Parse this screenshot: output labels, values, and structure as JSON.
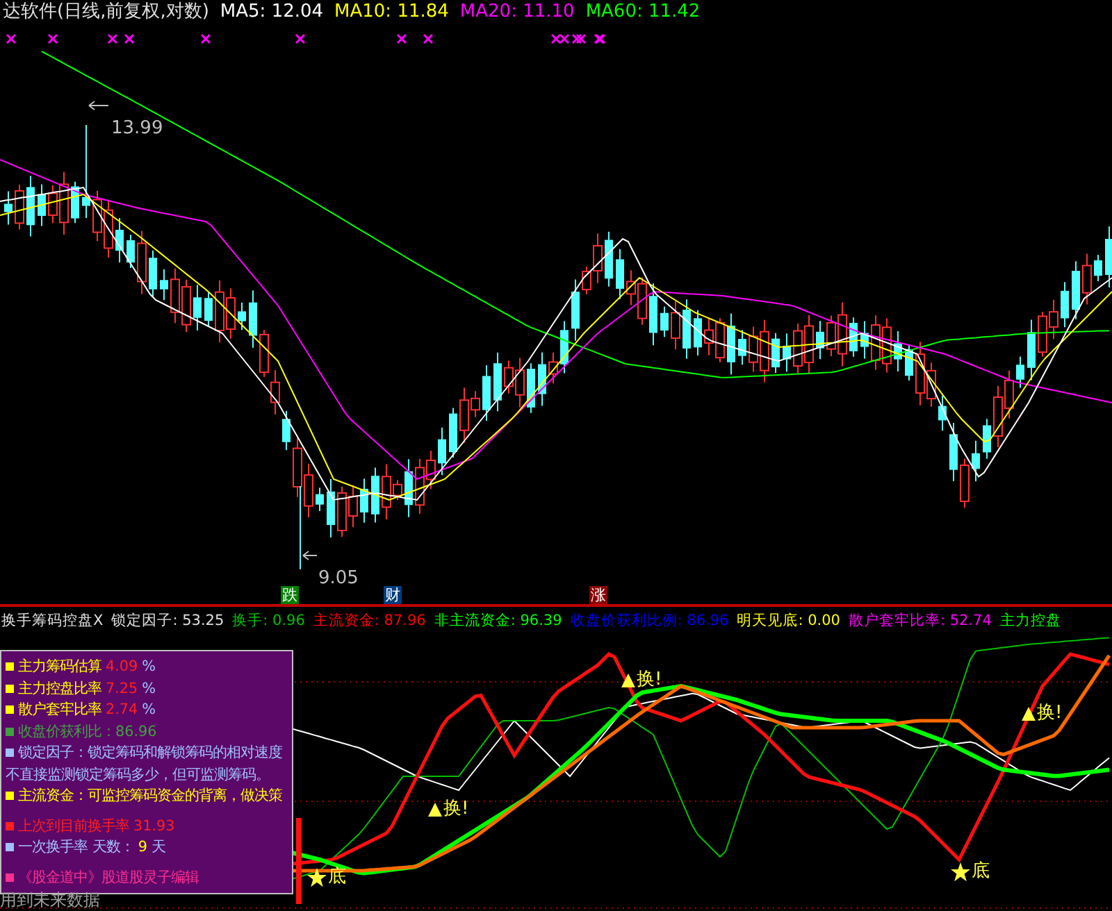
{
  "header": {
    "title": "达软件(日线,前复权,对数)",
    "ma": [
      {
        "label": "MA5: 12.04",
        "color": "#ffffff"
      },
      {
        "label": "MA10: 11.84",
        "color": "#ffff00"
      },
      {
        "label": "MA20: 11.10",
        "color": "#ff00ff"
      },
      {
        "label": "MA60: 11.42",
        "color": "#00ff00"
      }
    ]
  },
  "price_chart": {
    "high_label": "13.99",
    "low_label": "9.05",
    "badges": [
      {
        "text": "跌",
        "color": "#008000"
      },
      {
        "text": "财",
        "color": "#003f7f"
      },
      {
        "text": "涨",
        "color": "#8b0000"
      }
    ]
  },
  "indicator": {
    "name": "换手筹码控盘X",
    "readings": [
      {
        "text": "锁定因子: 53.25",
        "color": "#e0e0e0"
      },
      {
        "text": "换手: 0.96",
        "color": "#00c000"
      },
      {
        "text": "主流资金: 87.96",
        "color": "#ff0000"
      },
      {
        "text": "非主流资金: 96.39",
        "color": "#00ff00"
      },
      {
        "text": "收盘价获利比例: 86.96",
        "color": "#0000ff"
      },
      {
        "text": "明天见底: 0.00",
        "color": "#ffff00"
      },
      {
        "text": "散户套牢比率: 52.74",
        "color": "#ff00ff"
      },
      {
        "text": "主力控盘",
        "color": "#00ff00"
      }
    ]
  },
  "lower_chart": {
    "signals": [
      {
        "kind": "bottom",
        "text": "底"
      },
      {
        "kind": "swap",
        "text": "换!"
      },
      {
        "kind": "swap",
        "text": "换!"
      },
      {
        "kind": "bottom",
        "text": "底"
      },
      {
        "kind": "swap",
        "text": "换!"
      }
    ]
  },
  "info_panel": {
    "lines": [
      {
        "kind": "stat",
        "text": "主力筹码估算",
        "value": "4.09",
        "unit": "%",
        "color": "#ffff00"
      },
      {
        "kind": "stat",
        "text": "主力控盘比率",
        "value": "7.25",
        "unit": "%",
        "color": "#ffff00"
      },
      {
        "kind": "stat",
        "text": "散户套牢比率",
        "value": "2.74",
        "unit": "%",
        "color": "#ffff00"
      },
      {
        "kind": "note",
        "text": "收盘价获利比：86.96",
        "color": "#40a040"
      },
      {
        "kind": "note",
        "text": "锁定因子：锁定筹码和解锁筹码的相对速度",
        "color": "#a0c0ff"
      },
      {
        "kind": "plain",
        "text": "不直接监测锁定筹码多少，但可监测筹码。",
        "color": "#a0c0ff"
      },
      {
        "kind": "note",
        "text": "主流资金：可监控筹码资金的背离，做决策",
        "color": "#ffff00"
      },
      {
        "kind": "stat",
        "text": "上次到目前换手率",
        "value": "31.93",
        "color": "#ff2020"
      },
      {
        "kind": "stat",
        "text": "一次换手率 天数：",
        "value": "9",
        "unit": "天",
        "color": "#a0c0ff"
      },
      {
        "kind": "note",
        "text": "《股金道中》股道股灵子编辑",
        "color": "#ff3090"
      }
    ]
  },
  "note": "用到未来数据"
}
